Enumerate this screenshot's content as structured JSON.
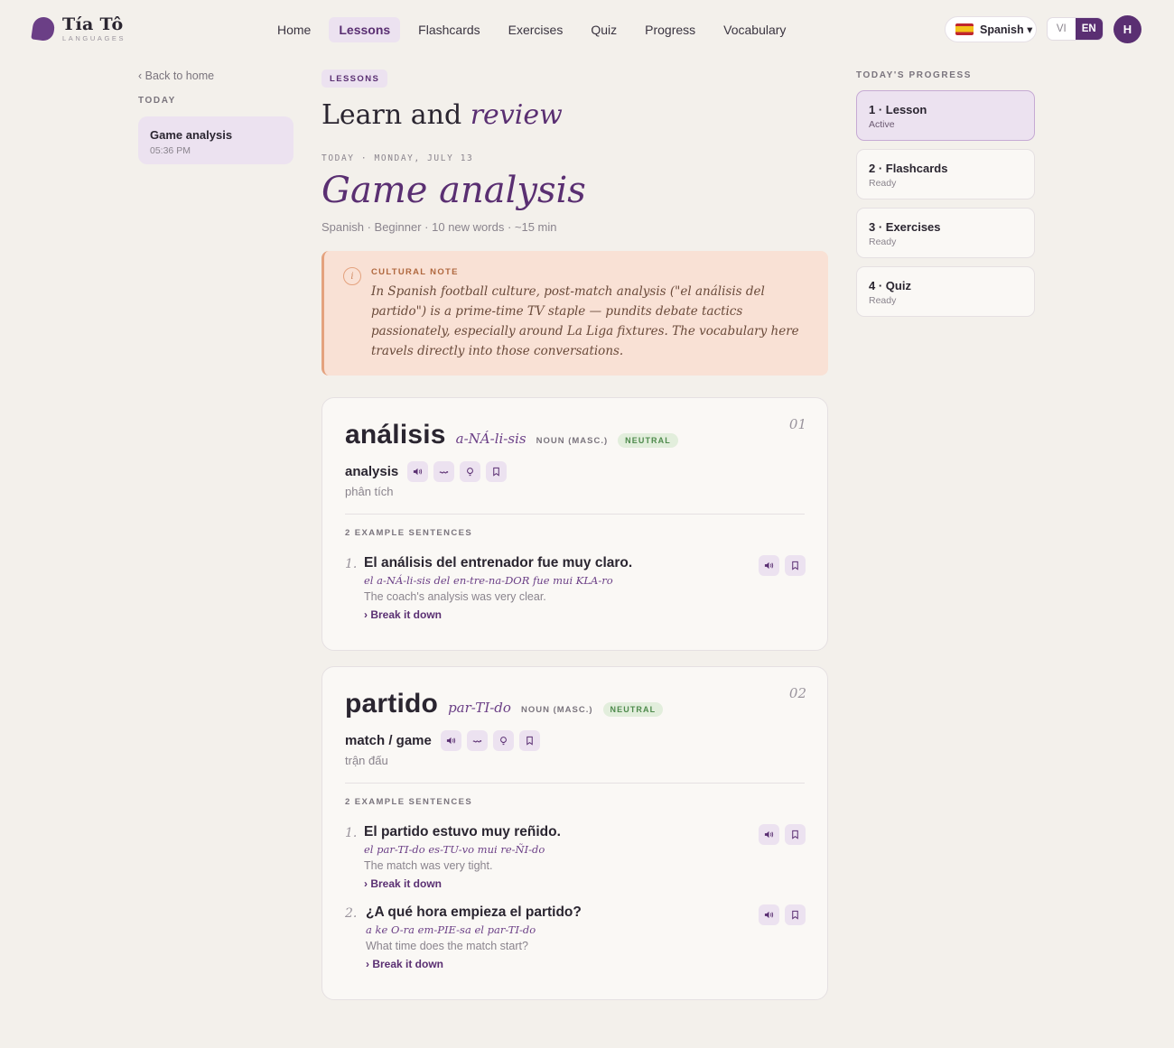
{
  "brand": {
    "name": "Tía Tô",
    "sub": "LANGUAGES"
  },
  "nav": [
    {
      "label": "Home",
      "active": false
    },
    {
      "label": "Lessons",
      "active": true
    },
    {
      "label": "Flashcards",
      "active": false
    },
    {
      "label": "Exercises",
      "active": false
    },
    {
      "label": "Quiz",
      "active": false
    },
    {
      "label": "Progress",
      "active": false
    },
    {
      "label": "Vocabulary",
      "active": false
    }
  ],
  "language": {
    "selected": "Spanish ▾",
    "flag": "spain-flag-icon"
  },
  "ui_lang": {
    "options": [
      "VI",
      "EN"
    ],
    "selected": "EN"
  },
  "avatar": {
    "initial": "H"
  },
  "sidebar": {
    "back": "‹ Back to home",
    "heading": "TODAY",
    "session": {
      "title": "Game analysis",
      "time": "05:36 PM"
    }
  },
  "main": {
    "badge": "LESSONS",
    "title_plain": "Learn and",
    "title_em": "review",
    "date": "TODAY · MONDAY, JULY 13",
    "lesson_title": "Game analysis",
    "meta": "Spanish · Beginner · 10 new words · ~15 min",
    "culture": {
      "label": "CULTURAL NOTE",
      "icon": "info-icon",
      "glyph": "i",
      "text": "In Spanish football culture, post-match analysis (\"el análisis del partido\") is a prime-time TV staple — pundits debate tactics passionately, especially around La Liga fixtures. The vocabulary here travels directly into those conversations."
    },
    "words": [
      {
        "index": "01",
        "word": "análisis",
        "pron": "a-NÁ-li-sis",
        "pos": "NOUN (MASC.)",
        "register": "NEUTRAL",
        "en": "analysis",
        "vi": "phân tích",
        "examples_label": "2 EXAMPLE SENTENCES",
        "examples": [
          {
            "num": "1.",
            "es": "El análisis del entrenador fue muy claro.",
            "pron": "el a-NÁ-li-sis del en-tre-na-DOR fue mui KLA-ro",
            "en": "The coach's analysis was very clear.",
            "action": "› Break it down"
          }
        ]
      },
      {
        "index": "02",
        "word": "partido",
        "pron": "par-TI-do",
        "pos": "NOUN (MASC.)",
        "register": "NEUTRAL",
        "en": "match / game",
        "vi": "trận đấu",
        "examples_label": "2 EXAMPLE SENTENCES",
        "examples": [
          {
            "num": "1.",
            "es": "El partido estuvo muy reñido.",
            "pron": "el par-TI-do es-TU-vo mui re-ÑI-do",
            "en": "The match was very tight.",
            "action": "› Break it down"
          },
          {
            "num": "2.",
            "es": "¿A qué hora empieza el partido?",
            "pron": "a ke O-ra em-PIE-sa el par-TI-do",
            "en": "What time does the match start?",
            "action": "› Break it down"
          }
        ]
      }
    ]
  },
  "progress": {
    "heading": "TODAY'S PROGRESS",
    "steps": [
      {
        "title": "1 · Lesson",
        "status": "Active",
        "active": true
      },
      {
        "title": "2 · Flashcards",
        "status": "Ready",
        "active": false
      },
      {
        "title": "3 · Exercises",
        "status": "Ready",
        "active": false
      },
      {
        "title": "4 · Quiz",
        "status": "Ready",
        "active": false
      }
    ]
  },
  "colors": {
    "accent": "#5a2f72",
    "accent_soft": "#ece2f0",
    "note_bg": "#f9e1d5",
    "neutral_tag": "#4e8a4c",
    "page_bg": "#f3f0eb"
  }
}
